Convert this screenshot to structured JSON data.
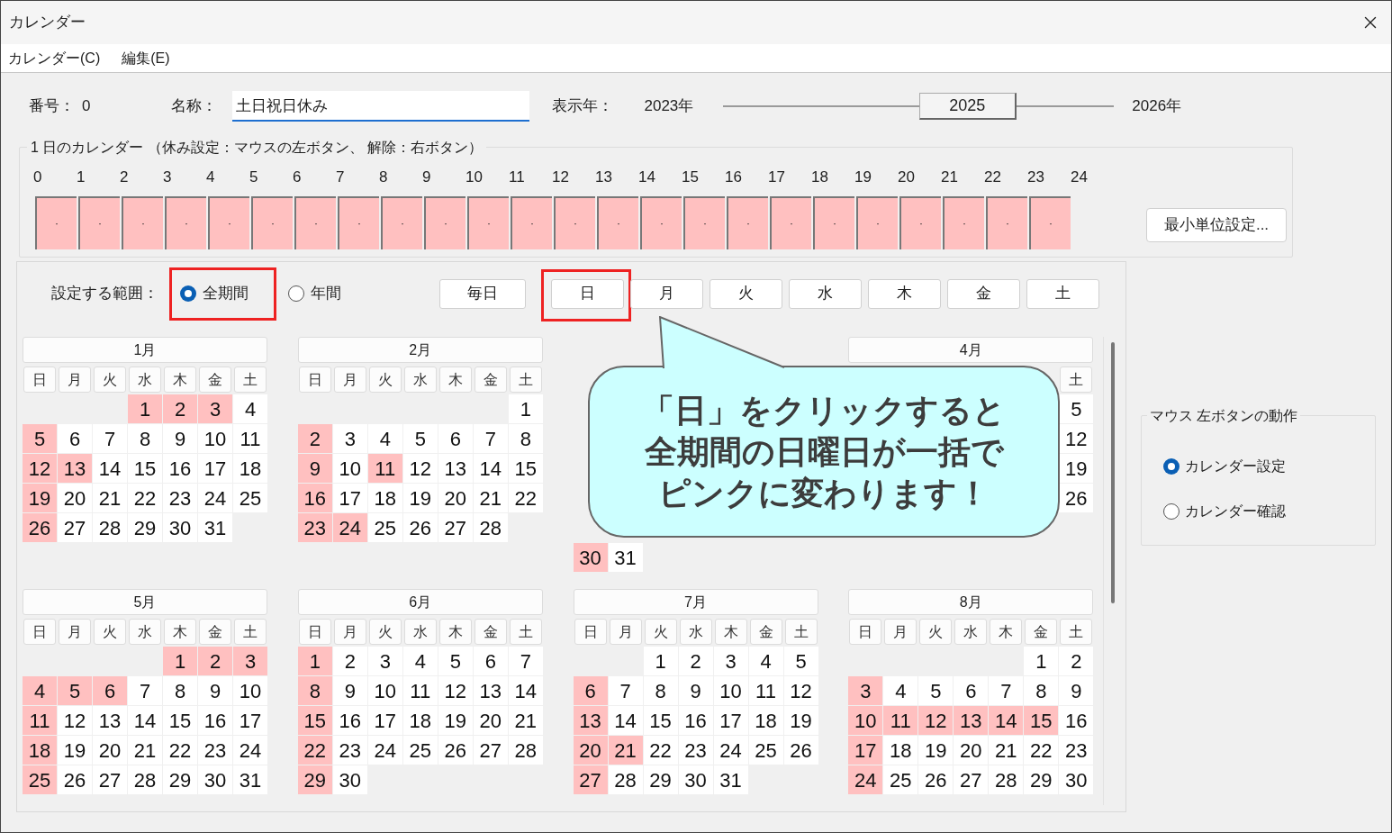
{
  "window": {
    "title": "カレンダー"
  },
  "menu": [
    "カレンダー(C)",
    "編集(E)"
  ],
  "header": {
    "number_label": "番号：",
    "number": "0",
    "name_label": "名称：",
    "name": "土日祝日休み",
    "year_label": "表示年：",
    "year_min": "2023年",
    "year_max": "2026年",
    "year_slider": {
      "value": "2025",
      "level": 0.667
    }
  },
  "day_calendar": {
    "legend": "1 日のカレンダー （休み設定：マウスの左ボタン、 解除：右ボタン）",
    "hour_labels": [
      "0",
      "1",
      "2",
      "3",
      "4",
      "5",
      "6",
      "7",
      "8",
      "9",
      "10",
      "11",
      "12",
      "13",
      "14",
      "15",
      "16",
      "17",
      "18",
      "19",
      "20",
      "21",
      "22",
      "23",
      "24"
    ],
    "slots": [
      {
        "label": "·",
        "holiday": true
      },
      {
        "label": "·",
        "holiday": true
      },
      {
        "label": "·",
        "holiday": true
      },
      {
        "label": "·",
        "holiday": true
      },
      {
        "label": "·",
        "holiday": true
      },
      {
        "label": "·",
        "holiday": true
      },
      {
        "label": "·",
        "holiday": true
      },
      {
        "label": "·",
        "holiday": true
      },
      {
        "label": "·",
        "holiday": true
      },
      {
        "label": "·",
        "holiday": true
      },
      {
        "label": "·",
        "holiday": true
      },
      {
        "label": "·",
        "holiday": true
      },
      {
        "label": "·",
        "holiday": true
      },
      {
        "label": "·",
        "holiday": true
      },
      {
        "label": "·",
        "holiday": true
      },
      {
        "label": "·",
        "holiday": true
      },
      {
        "label": "·",
        "holiday": true
      },
      {
        "label": "·",
        "holiday": true
      },
      {
        "label": "·",
        "holiday": true
      },
      {
        "label": "·",
        "holiday": true
      },
      {
        "label": "·",
        "holiday": true
      },
      {
        "label": "·",
        "holiday": true
      },
      {
        "label": "·",
        "holiday": true
      },
      {
        "label": "·",
        "holiday": true
      }
    ],
    "button": "最小単位設定..."
  },
  "range": {
    "label": "設定する範囲：",
    "options": [
      {
        "label": "全期間",
        "selected": true,
        "highlighted": true
      },
      {
        "label": "年間",
        "selected": false,
        "highlighted": false
      }
    ]
  },
  "day_buttons": [
    {
      "label": "毎日",
      "highlighted": false
    },
    {
      "label": "日",
      "highlighted": true
    },
    {
      "label": "月",
      "highlighted": false
    },
    {
      "label": "火",
      "highlighted": false
    },
    {
      "label": "水",
      "highlighted": false
    },
    {
      "label": "木",
      "highlighted": false
    },
    {
      "label": "金",
      "highlighted": false
    },
    {
      "label": "土",
      "highlighted": false
    }
  ],
  "months": [
    {
      "title": "1月",
      "weekdays": [
        "日",
        "月",
        "火",
        "水",
        "木",
        "金",
        "土"
      ],
      "weeks": [
        [
          {
            "kind": "blank"
          },
          {
            "kind": "blank"
          },
          {
            "kind": "blank"
          },
          {
            "kind": "day",
            "day": "1",
            "holiday": true
          },
          {
            "kind": "day",
            "day": "2",
            "holiday": true
          },
          {
            "kind": "day",
            "day": "3",
            "holiday": true
          },
          {
            "kind": "day",
            "day": "4",
            "holiday": false
          }
        ],
        [
          {
            "kind": "day",
            "day": "5",
            "holiday": true
          },
          {
            "kind": "day",
            "day": "6",
            "holiday": false
          },
          {
            "kind": "day",
            "day": "7",
            "holiday": false
          },
          {
            "kind": "day",
            "day": "8",
            "holiday": false
          },
          {
            "kind": "day",
            "day": "9",
            "holiday": false
          },
          {
            "kind": "day",
            "day": "10",
            "holiday": false
          },
          {
            "kind": "day",
            "day": "11",
            "holiday": false
          }
        ],
        [
          {
            "kind": "day",
            "day": "12",
            "holiday": true
          },
          {
            "kind": "day",
            "day": "13",
            "holiday": true
          },
          {
            "kind": "day",
            "day": "14",
            "holiday": false
          },
          {
            "kind": "day",
            "day": "15",
            "holiday": false
          },
          {
            "kind": "day",
            "day": "16",
            "holiday": false
          },
          {
            "kind": "day",
            "day": "17",
            "holiday": false
          },
          {
            "kind": "day",
            "day": "18",
            "holiday": false
          }
        ],
        [
          {
            "kind": "day",
            "day": "19",
            "holiday": true
          },
          {
            "kind": "day",
            "day": "20",
            "holiday": false
          },
          {
            "kind": "day",
            "day": "21",
            "holiday": false
          },
          {
            "kind": "day",
            "day": "22",
            "holiday": false
          },
          {
            "kind": "day",
            "day": "23",
            "holiday": false
          },
          {
            "kind": "day",
            "day": "24",
            "holiday": false
          },
          {
            "kind": "day",
            "day": "25",
            "holiday": false
          }
        ],
        [
          {
            "kind": "day",
            "day": "26",
            "holiday": true
          },
          {
            "kind": "day",
            "day": "27",
            "holiday": false
          },
          {
            "kind": "day",
            "day": "28",
            "holiday": false
          },
          {
            "kind": "day",
            "day": "29",
            "holiday": false
          },
          {
            "kind": "day",
            "day": "30",
            "holiday": false
          },
          {
            "kind": "day",
            "day": "31",
            "holiday": false
          }
        ]
      ]
    },
    {
      "title": "2月",
      "weekdays": [
        "日",
        "月",
        "火",
        "水",
        "木",
        "金",
        "土"
      ],
      "weeks": [
        [
          {
            "kind": "blank"
          },
          {
            "kind": "blank"
          },
          {
            "kind": "blank"
          },
          {
            "kind": "blank"
          },
          {
            "kind": "blank"
          },
          {
            "kind": "blank"
          },
          {
            "kind": "day",
            "day": "1",
            "holiday": false
          }
        ],
        [
          {
            "kind": "day",
            "day": "2",
            "holiday": true
          },
          {
            "kind": "day",
            "day": "3",
            "holiday": false
          },
          {
            "kind": "day",
            "day": "4",
            "holiday": false
          },
          {
            "kind": "day",
            "day": "5",
            "holiday": false
          },
          {
            "kind": "day",
            "day": "6",
            "holiday": false
          },
          {
            "kind": "day",
            "day": "7",
            "holiday": false
          },
          {
            "kind": "day",
            "day": "8",
            "holiday": false
          }
        ],
        [
          {
            "kind": "day",
            "day": "9",
            "holiday": true
          },
          {
            "kind": "day",
            "day": "10",
            "holiday": false
          },
          {
            "kind": "day",
            "day": "11",
            "holiday": true
          },
          {
            "kind": "day",
            "day": "12",
            "holiday": false
          },
          {
            "kind": "day",
            "day": "13",
            "holiday": false
          },
          {
            "kind": "day",
            "day": "14",
            "holiday": false
          },
          {
            "kind": "day",
            "day": "15",
            "holiday": false
          }
        ],
        [
          {
            "kind": "day",
            "day": "16",
            "holiday": true
          },
          {
            "kind": "day",
            "day": "17",
            "holiday": false
          },
          {
            "kind": "day",
            "day": "18",
            "holiday": false
          },
          {
            "kind": "day",
            "day": "19",
            "holiday": false
          },
          {
            "kind": "day",
            "day": "20",
            "holiday": false
          },
          {
            "kind": "day",
            "day": "21",
            "holiday": false
          },
          {
            "kind": "day",
            "day": "22",
            "holiday": false
          }
        ],
        [
          {
            "kind": "day",
            "day": "23",
            "holiday": true
          },
          {
            "kind": "day",
            "day": "24",
            "holiday": true
          },
          {
            "kind": "day",
            "day": "25",
            "holiday": false
          },
          {
            "kind": "day",
            "day": "26",
            "holiday": false
          },
          {
            "kind": "day",
            "day": "27",
            "holiday": false
          },
          {
            "kind": "day",
            "day": "28",
            "holiday": false
          }
        ]
      ]
    },
    {
      "weeks": [
        [
          {
            "kind": "blank"
          }
        ],
        [
          {
            "kind": "blank"
          }
        ],
        [
          {
            "kind": "blank"
          }
        ],
        [
          {
            "kind": "blank"
          }
        ],
        [
          {
            "kind": "blank"
          }
        ],
        [
          {
            "kind": "day",
            "day": "30",
            "holiday": true
          },
          {
            "kind": "day",
            "day": "31",
            "holiday": false
          }
        ]
      ]
    },
    {
      "title": "4月",
      "weekdays": [
        {
          "kind": "blank"
        },
        {
          "kind": "blank"
        },
        {
          "kind": "blank"
        },
        {
          "kind": "blank"
        },
        {
          "kind": "blank"
        },
        {
          "kind": "blank"
        },
        "土"
      ],
      "weeks": [
        [
          {
            "kind": "blank"
          },
          {
            "kind": "blank"
          },
          {
            "kind": "blank"
          },
          {
            "kind": "blank"
          },
          {
            "kind": "blank"
          },
          {
            "kind": "blank"
          },
          {
            "kind": "day",
            "day": "5",
            "holiday": false
          }
        ],
        [
          {
            "kind": "blank"
          },
          {
            "kind": "blank"
          },
          {
            "kind": "blank"
          },
          {
            "kind": "blank"
          },
          {
            "kind": "blank"
          },
          {
            "kind": "blank"
          },
          {
            "kind": "day",
            "day": "12",
            "holiday": false
          }
        ],
        [
          {
            "kind": "blank"
          },
          {
            "kind": "blank"
          },
          {
            "kind": "blank"
          },
          {
            "kind": "blank"
          },
          {
            "kind": "blank"
          },
          {
            "kind": "blank"
          },
          {
            "kind": "day",
            "day": "19",
            "holiday": false
          }
        ],
        [
          {
            "kind": "blank"
          },
          {
            "kind": "blank"
          },
          {
            "kind": "blank"
          },
          {
            "kind": "blank"
          },
          {
            "kind": "blank"
          },
          {
            "kind": "blank"
          },
          {
            "kind": "day",
            "day": "26",
            "holiday": false
          }
        ]
      ]
    },
    {
      "title": "5月",
      "weekdays": [
        "日",
        "月",
        "火",
        "水",
        "木",
        "金",
        "土"
      ],
      "weeks": [
        [
          {
            "kind": "blank"
          },
          {
            "kind": "blank"
          },
          {
            "kind": "blank"
          },
          {
            "kind": "blank"
          },
          {
            "kind": "day",
            "day": "1",
            "holiday": true
          },
          {
            "kind": "day",
            "day": "2",
            "holiday": true
          },
          {
            "kind": "day",
            "day": "3",
            "holiday": true
          }
        ],
        [
          {
            "kind": "day",
            "day": "4",
            "holiday": true
          },
          {
            "kind": "day",
            "day": "5",
            "holiday": true
          },
          {
            "kind": "day",
            "day": "6",
            "holiday": true
          },
          {
            "kind": "day",
            "day": "7",
            "holiday": false
          },
          {
            "kind": "day",
            "day": "8",
            "holiday": false
          },
          {
            "kind": "day",
            "day": "9",
            "holiday": false
          },
          {
            "kind": "day",
            "day": "10",
            "holiday": false
          }
        ],
        [
          {
            "kind": "day",
            "day": "11",
            "holiday": true
          },
          {
            "kind": "day",
            "day": "12",
            "holiday": false
          },
          {
            "kind": "day",
            "day": "13",
            "holiday": false
          },
          {
            "kind": "day",
            "day": "14",
            "holiday": false
          },
          {
            "kind": "day",
            "day": "15",
            "holiday": false
          },
          {
            "kind": "day",
            "day": "16",
            "holiday": false
          },
          {
            "kind": "day",
            "day": "17",
            "holiday": false
          }
        ],
        [
          {
            "kind": "day",
            "day": "18",
            "holiday": true
          },
          {
            "kind": "day",
            "day": "19",
            "holiday": false
          },
          {
            "kind": "day",
            "day": "20",
            "holiday": false
          },
          {
            "kind": "day",
            "day": "21",
            "holiday": false
          },
          {
            "kind": "day",
            "day": "22",
            "holiday": false
          },
          {
            "kind": "day",
            "day": "23",
            "holiday": false
          },
          {
            "kind": "day",
            "day": "24",
            "holiday": false
          }
        ],
        [
          {
            "kind": "day",
            "day": "25",
            "holiday": true
          },
          {
            "kind": "day",
            "day": "26",
            "holiday": false
          },
          {
            "kind": "day",
            "day": "27",
            "holiday": false
          },
          {
            "kind": "day",
            "day": "28",
            "holiday": false
          },
          {
            "kind": "day",
            "day": "29",
            "holiday": false
          },
          {
            "kind": "day",
            "day": "30",
            "holiday": false
          },
          {
            "kind": "day",
            "day": "31",
            "holiday": false
          }
        ]
      ]
    },
    {
      "title": "6月",
      "weekdays": [
        "日",
        "月",
        "火",
        "水",
        "木",
        "金",
        "土"
      ],
      "weeks": [
        [
          {
            "kind": "day",
            "day": "1",
            "holiday": true
          },
          {
            "kind": "day",
            "day": "2",
            "holiday": false
          },
          {
            "kind": "day",
            "day": "3",
            "holiday": false
          },
          {
            "kind": "day",
            "day": "4",
            "holiday": false
          },
          {
            "kind": "day",
            "day": "5",
            "holiday": false
          },
          {
            "kind": "day",
            "day": "6",
            "holiday": false
          },
          {
            "kind": "day",
            "day": "7",
            "holiday": false
          }
        ],
        [
          {
            "kind": "day",
            "day": "8",
            "holiday": true
          },
          {
            "kind": "day",
            "day": "9",
            "holiday": false
          },
          {
            "kind": "day",
            "day": "10",
            "holiday": false
          },
          {
            "kind": "day",
            "day": "11",
            "holiday": false
          },
          {
            "kind": "day",
            "day": "12",
            "holiday": false
          },
          {
            "kind": "day",
            "day": "13",
            "holiday": false
          },
          {
            "kind": "day",
            "day": "14",
            "holiday": false
          }
        ],
        [
          {
            "kind": "day",
            "day": "15",
            "holiday": true
          },
          {
            "kind": "day",
            "day": "16",
            "holiday": false
          },
          {
            "kind": "day",
            "day": "17",
            "holiday": false
          },
          {
            "kind": "day",
            "day": "18",
            "holiday": false
          },
          {
            "kind": "day",
            "day": "19",
            "holiday": false
          },
          {
            "kind": "day",
            "day": "20",
            "holiday": false
          },
          {
            "kind": "day",
            "day": "21",
            "holiday": false
          }
        ],
        [
          {
            "kind": "day",
            "day": "22",
            "holiday": true
          },
          {
            "kind": "day",
            "day": "23",
            "holiday": false
          },
          {
            "kind": "day",
            "day": "24",
            "holiday": false
          },
          {
            "kind": "day",
            "day": "25",
            "holiday": false
          },
          {
            "kind": "day",
            "day": "26",
            "holiday": false
          },
          {
            "kind": "day",
            "day": "27",
            "holiday": false
          },
          {
            "kind": "day",
            "day": "28",
            "holiday": false
          }
        ],
        [
          {
            "kind": "day",
            "day": "29",
            "holiday": true
          },
          {
            "kind": "day",
            "day": "30",
            "holiday": false
          }
        ]
      ]
    },
    {
      "title": "7月",
      "weekdays": [
        "日",
        "月",
        "火",
        "水",
        "木",
        "金",
        "土"
      ],
      "weeks": [
        [
          {
            "kind": "blank"
          },
          {
            "kind": "blank"
          },
          {
            "kind": "day",
            "day": "1",
            "holiday": false
          },
          {
            "kind": "day",
            "day": "2",
            "holiday": false
          },
          {
            "kind": "day",
            "day": "3",
            "holiday": false
          },
          {
            "kind": "day",
            "day": "4",
            "holiday": false
          },
          {
            "kind": "day",
            "day": "5",
            "holiday": false
          }
        ],
        [
          {
            "kind": "day",
            "day": "6",
            "holiday": true
          },
          {
            "kind": "day",
            "day": "7",
            "holiday": false
          },
          {
            "kind": "day",
            "day": "8",
            "holiday": false
          },
          {
            "kind": "day",
            "day": "9",
            "holiday": false
          },
          {
            "kind": "day",
            "day": "10",
            "holiday": false
          },
          {
            "kind": "day",
            "day": "11",
            "holiday": false
          },
          {
            "kind": "day",
            "day": "12",
            "holiday": false
          }
        ],
        [
          {
            "kind": "day",
            "day": "13",
            "holiday": true
          },
          {
            "kind": "day",
            "day": "14",
            "holiday": false
          },
          {
            "kind": "day",
            "day": "15",
            "holiday": false
          },
          {
            "kind": "day",
            "day": "16",
            "holiday": false
          },
          {
            "kind": "day",
            "day": "17",
            "holiday": false
          },
          {
            "kind": "day",
            "day": "18",
            "holiday": false
          },
          {
            "kind": "day",
            "day": "19",
            "holiday": false
          }
        ],
        [
          {
            "kind": "day",
            "day": "20",
            "holiday": true
          },
          {
            "kind": "day",
            "day": "21",
            "holiday": true
          },
          {
            "kind": "day",
            "day": "22",
            "holiday": false
          },
          {
            "kind": "day",
            "day": "23",
            "holiday": false
          },
          {
            "kind": "day",
            "day": "24",
            "holiday": false
          },
          {
            "kind": "day",
            "day": "25",
            "holiday": false
          },
          {
            "kind": "day",
            "day": "26",
            "holiday": false
          }
        ],
        [
          {
            "kind": "day",
            "day": "27",
            "holiday": true
          },
          {
            "kind": "day",
            "day": "28",
            "holiday": false
          },
          {
            "kind": "day",
            "day": "29",
            "holiday": false
          },
          {
            "kind": "day",
            "day": "30",
            "holiday": false
          },
          {
            "kind": "day",
            "day": "31",
            "holiday": false
          }
        ]
      ]
    },
    {
      "title": "8月",
      "weekdays": [
        "日",
        "月",
        "火",
        "水",
        "木",
        "金",
        "土"
      ],
      "weeks": [
        [
          {
            "kind": "blank"
          },
          {
            "kind": "blank"
          },
          {
            "kind": "blank"
          },
          {
            "kind": "blank"
          },
          {
            "kind": "blank"
          },
          {
            "kind": "day",
            "day": "1",
            "holiday": false
          },
          {
            "kind": "day",
            "day": "2",
            "holiday": false
          }
        ],
        [
          {
            "kind": "day",
            "day": "3",
            "holiday": true
          },
          {
            "kind": "day",
            "day": "4",
            "holiday": false
          },
          {
            "kind": "day",
            "day": "5",
            "holiday": false
          },
          {
            "kind": "day",
            "day": "6",
            "holiday": false
          },
          {
            "kind": "day",
            "day": "7",
            "holiday": false
          },
          {
            "kind": "day",
            "day": "8",
            "holiday": false
          },
          {
            "kind": "day",
            "day": "9",
            "holiday": false
          }
        ],
        [
          {
            "kind": "day",
            "day": "10",
            "holiday": true
          },
          {
            "kind": "day",
            "day": "11",
            "holiday": true
          },
          {
            "kind": "day",
            "day": "12",
            "holiday": true
          },
          {
            "kind": "day",
            "day": "13",
            "holiday": true
          },
          {
            "kind": "day",
            "day": "14",
            "holiday": true
          },
          {
            "kind": "day",
            "day": "15",
            "holiday": true
          },
          {
            "kind": "day",
            "day": "16",
            "holiday": false
          }
        ],
        [
          {
            "kind": "day",
            "day": "17",
            "holiday": true
          },
          {
            "kind": "day",
            "day": "18",
            "holiday": false
          },
          {
            "kind": "day",
            "day": "19",
            "holiday": false
          },
          {
            "kind": "day",
            "day": "20",
            "holiday": false
          },
          {
            "kind": "day",
            "day": "21",
            "holiday": false
          },
          {
            "kind": "day",
            "day": "22",
            "holiday": false
          },
          {
            "kind": "day",
            "day": "23",
            "holiday": false
          }
        ],
        [
          {
            "kind": "day",
            "day": "24",
            "holiday": true
          },
          {
            "kind": "day",
            "day": "25",
            "holiday": false
          },
          {
            "kind": "day",
            "day": "26",
            "holiday": false
          },
          {
            "kind": "day",
            "day": "27",
            "holiday": false
          },
          {
            "kind": "day",
            "day": "28",
            "holiday": false
          },
          {
            "kind": "day",
            "day": "29",
            "holiday": false
          },
          {
            "kind": "day",
            "day": "30",
            "holiday": false
          }
        ]
      ]
    }
  ],
  "mouse_group": {
    "legend": "マウス 左ボタンの動作",
    "options": [
      {
        "label": "カレンダー設定",
        "selected": true
      },
      {
        "label": "カレンダー確認",
        "selected": false
      }
    ]
  },
  "callout": {
    "lines": [
      "「日」をクリックすると",
      "全期間の日曜日が一括で",
      "ピンクに変わります！"
    ]
  }
}
